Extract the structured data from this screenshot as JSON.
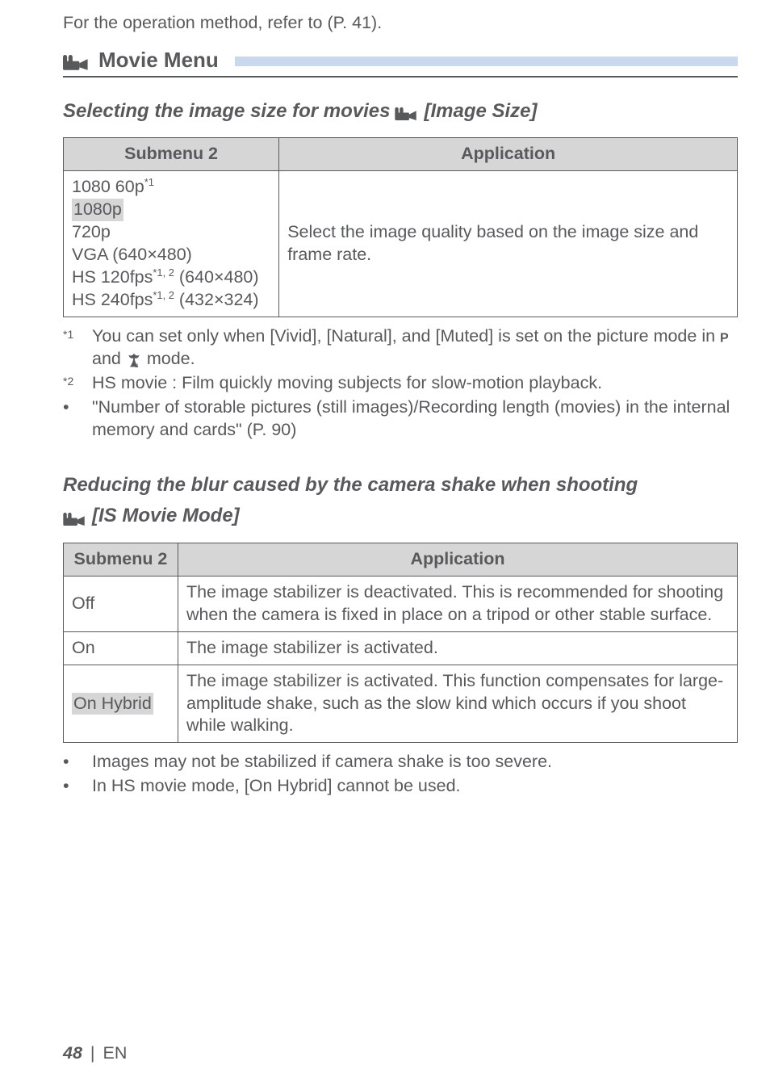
{
  "intro": "For the operation method, refer to (P. 41).",
  "movie_menu_title": "Movie Menu",
  "movie_icon_name": "movie-camera-icon",
  "section_image_size": {
    "heading_before": "Selecting the image size for movies",
    "heading_after": "[Image Size]",
    "table": {
      "headers": {
        "submenu": "Submenu 2",
        "application": "Application"
      },
      "rows": [
        {
          "l1": "1080 60p",
          "l1_sup": "*1",
          "l2": "1080p",
          "l3": "720p",
          "l4": "VGA (640×480)",
          "l5_a": "HS 120fps",
          "l5_sup": "*1, 2",
          "l5_b": " (640×480)",
          "l6_a": "HS 240fps",
          "l6_sup": "*1, 2",
          "l6_b": " (432×324)"
        }
      ],
      "application_text": "Select the image quality based on the image size and frame rate."
    },
    "footnotes": [
      {
        "marker": "*1",
        "sup": true,
        "text_a": "You can set only when [Vivid], [Natural], and [Muted] is set on the picture mode in ",
        "text_b": " and ",
        "text_c": " mode."
      },
      {
        "marker": "*2",
        "sup": true,
        "text": "HS movie : Film quickly moving subjects for slow-motion playback."
      },
      {
        "marker": "•",
        "sup": false,
        "text": "\"Number of storable pictures (still images)/Recording length (movies) in the internal memory and cards\" (P. 90)"
      }
    ]
  },
  "section_is": {
    "heading_line1": "Reducing the blur caused by the camera shake when shooting",
    "heading_after": "[IS Movie Mode]",
    "table": {
      "headers": {
        "submenu": "Submenu 2",
        "application": "Application"
      },
      "rows": [
        {
          "submenu": "Off",
          "hl": false,
          "app": "The image stabilizer is deactivated. This is recommended for shooting when the camera is fixed in place on a tripod or other stable surface."
        },
        {
          "submenu": "On",
          "hl": false,
          "app": "The image stabilizer is activated."
        },
        {
          "submenu": "On Hybrid",
          "hl": true,
          "app": "The image stabilizer is activated. This function compensates for large-amplitude shake, such as the slow kind which occurs if you shoot while walking."
        }
      ]
    },
    "notes": [
      "Images may not be stabilized if camera shake is too severe.",
      "In HS movie mode, [On Hybrid] cannot be used."
    ]
  },
  "page_number": "48",
  "page_lang": "EN"
}
